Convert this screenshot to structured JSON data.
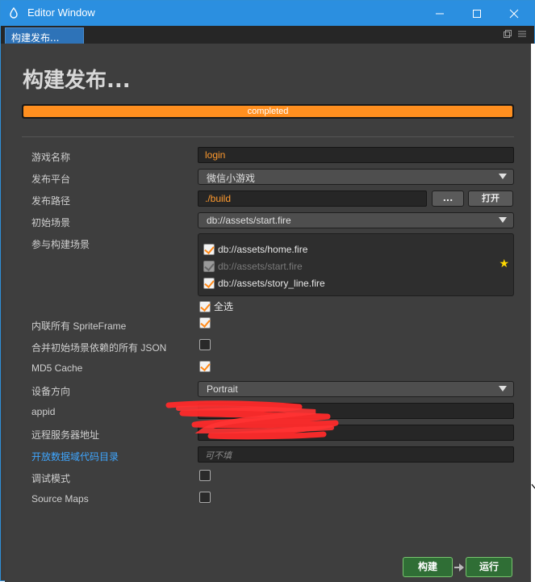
{
  "window": {
    "title": "Editor Window",
    "tab": "构建发布..."
  },
  "page": {
    "heading": "构建发布...",
    "progress_label": "completed",
    "progress_fraction": 1.0
  },
  "form": {
    "game_name_label": "游戏名称",
    "game_name_value": "login",
    "platform_label": "发布平台",
    "platform_value": "微信小游戏",
    "path_label": "发布路径",
    "path_value": "./build",
    "path_browse": "...",
    "path_open": "打开",
    "start_scene_label": "初始场景",
    "start_scene_value": "db://assets/start.fire",
    "scenes_label": "参与构建场景",
    "scenes": [
      {
        "name": "db://assets/home.fire",
        "checked": true,
        "disabled": false
      },
      {
        "name": "db://assets/start.fire",
        "checked": true,
        "disabled": true
      },
      {
        "name": "db://assets/story_line.fire",
        "checked": true,
        "disabled": false
      }
    ],
    "select_all": "全选",
    "inline_sprite_label": "内联所有 SpriteFrame",
    "merge_json_label": "合并初始场景依赖的所有 JSON",
    "md5_label": "MD5 Cache",
    "orientation_label": "设备方向",
    "orientation_value": "Portrait",
    "appid_label": "appid",
    "remote_label": "远程服务器地址",
    "open_data_label": "开放数据域代码目录",
    "open_data_placeholder": "可不填",
    "debug_label": "调试模式",
    "sourcemaps_label": "Source Maps"
  },
  "actions": {
    "build": "构建",
    "run": "运行"
  },
  "colors": {
    "accent": "#ff8f1f",
    "titlebar": "#2b8fe0",
    "link": "#3fa6ff",
    "action_button": "#2f6e35"
  }
}
